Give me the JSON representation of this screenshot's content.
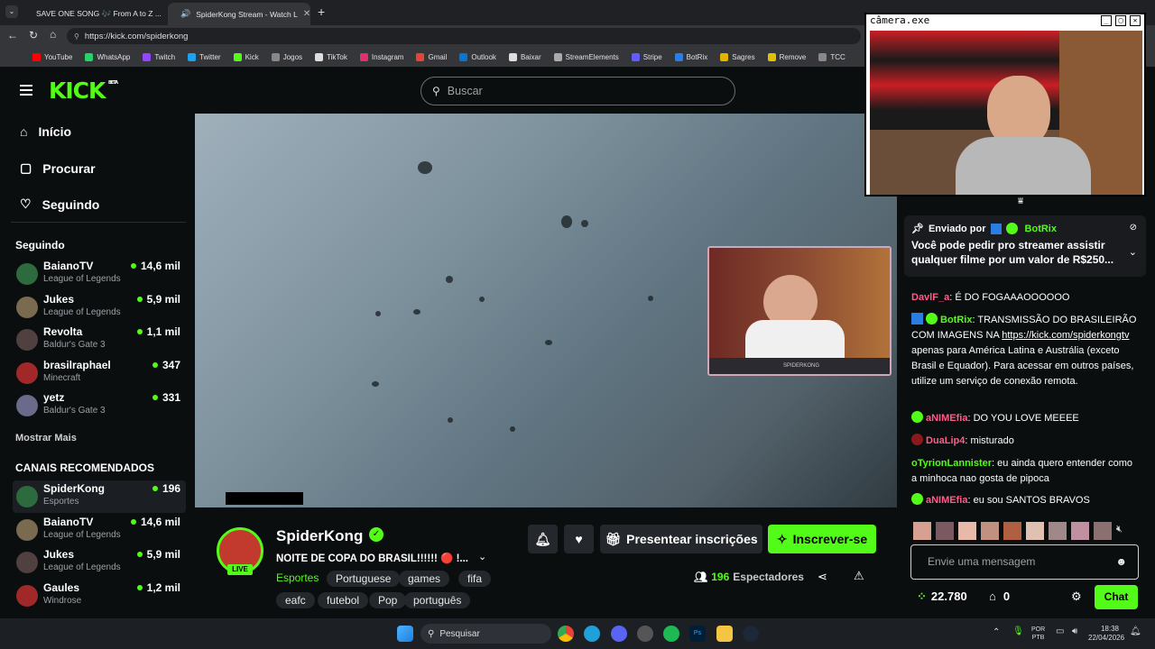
{
  "browser": {
    "tabs": [
      {
        "label": "SAVE ONE SONG 🎶 From A to Z ..."
      },
      {
        "label": "SpiderKong Stream - Watch L"
      }
    ],
    "url": "https://kick.com/spiderkong",
    "bookmarks": [
      "YouTube",
      "WhatsApp",
      "Twitch",
      "Twitter",
      "Kick",
      "Jogos",
      "TikTok",
      "Instagram",
      "Gmail",
      "Outlook",
      "Baixar",
      "StreamElements",
      "Stripe",
      "BotRix",
      "Sagres",
      "Remove",
      "TCC"
    ]
  },
  "kick": {
    "logo": "KICK",
    "logo_badge": "BETA",
    "search_placeholder": "Buscar",
    "nav": [
      "Início",
      "Procurar",
      "Seguindo"
    ],
    "following_title": "Seguindo",
    "following": [
      {
        "name": "BaianoTV",
        "game": "League of Legends",
        "viewers": "14,6 mil"
      },
      {
        "name": "Jukes",
        "game": "League of Legends",
        "viewers": "5,9 mil"
      },
      {
        "name": "Revolta",
        "game": "Baldur's Gate 3",
        "viewers": "1,1 mil"
      },
      {
        "name": "brasilraphael",
        "game": "Minecraft",
        "viewers": "347"
      },
      {
        "name": "yetz",
        "game": "Baldur's Gate 3",
        "viewers": "331"
      }
    ],
    "show_more": "Mostrar Mais",
    "recommended_title": "CANAIS RECOMENDADOS",
    "recommended": [
      {
        "name": "SpiderKong",
        "game": "Esportes",
        "viewers": "196"
      },
      {
        "name": "BaianoTV",
        "game": "League of Legends",
        "viewers": "14,6 mil"
      },
      {
        "name": "Jukes",
        "game": "League of Legends",
        "viewers": "5,9 mil"
      },
      {
        "name": "Gaules",
        "game": "Windrose",
        "viewers": "1,2 mil"
      }
    ]
  },
  "stream": {
    "channel": "SpiderKong",
    "live": "LIVE",
    "title": "NOITE DE COPA DO BRASIL!!!!!! 🔴 !...",
    "category": "Esportes",
    "tags": [
      "Portuguese",
      "games",
      "fifa",
      "eafc",
      "futebol",
      "Pop",
      "português"
    ],
    "gift_label": "Presentear inscrições",
    "subscribe_label": "Inscrever-se",
    "viewers": "196",
    "viewers_label": "Espectadores",
    "overlay_name": "SPIDERKONG"
  },
  "chat": {
    "pinned_by": "Enviado por",
    "pinned_user": "BotRix",
    "pinned_text": "Você pode pedir pro streamer assistir qualquer filme por um valor de R$250...",
    "messages": [
      {
        "user": "DavlF_a",
        "text": "É DO FOGAAAOOOOOO",
        "color": "#ff5c8a"
      },
      {
        "user": "BotRix",
        "text": "TRANSMISSÃO DO BRASILEIRÃO COM IMAGENS NA ",
        "link": "https://kick.com/spiderkongtv",
        "text2": " apenas para América Latina e Austrália (exceto Brasil e Equador). Para acessar em outros países, utilize um serviço de conexão remota.",
        "color": "#53fc18"
      },
      {
        "user": "aNIMEfia",
        "text": "DO YOU LOVE MEEEE",
        "color": "#ff5c8a"
      },
      {
        "user": "DuaLip4",
        "text": "misturado",
        "color": "#ff5c8a"
      },
      {
        "user": "oTyrionLannister",
        "text": "eu ainda quero entender como a minhoca nao gosta de pipoca",
        "color": "#53fc18"
      },
      {
        "user": "aNIMEfia",
        "text": "eu sou SANTOS BRAVOS",
        "color": "#ff5c8a"
      }
    ],
    "input_placeholder": "Envie uma mensagem",
    "points": "22.780",
    "bag_count": "0",
    "chat_button": "Chat"
  },
  "camera_window": {
    "title": "câmera.exe"
  },
  "taskbar": {
    "search": "Pesquisar",
    "lang1": "POR",
    "lang2": "PTB",
    "time": "18:38",
    "date": "22/04/2026"
  }
}
